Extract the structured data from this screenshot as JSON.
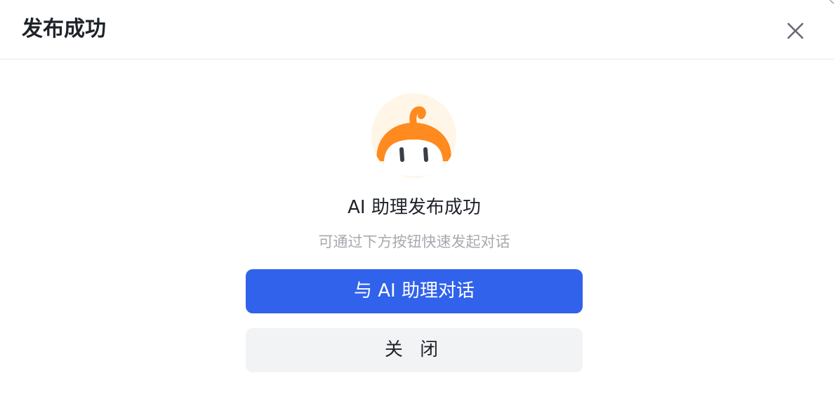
{
  "dialog": {
    "title": "发布成功",
    "close_icon": "close-icon"
  },
  "content": {
    "avatar_icon": "robot-mascot-icon",
    "headline": "AI 助理发布成功",
    "subtext": "可通过下方按钮快速发起对话"
  },
  "actions": {
    "primary_label": "与 AI 助理对话",
    "secondary_label": "关 闭"
  },
  "colors": {
    "primary": "#3162eb",
    "secondary_bg": "#f2f3f5",
    "mascot_orange": "#ff8a1f",
    "avatar_bg": "#fff6e8"
  }
}
